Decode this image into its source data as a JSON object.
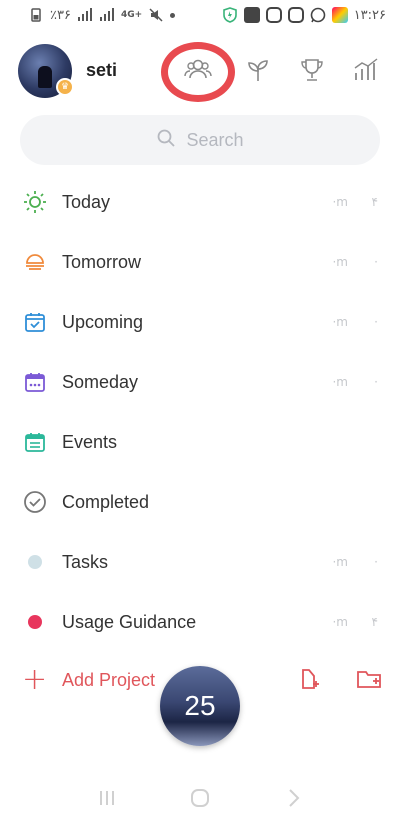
{
  "status_bar": {
    "battery": "٪۳۶",
    "network": "4G+",
    "time": "۱۳:۲۶"
  },
  "header": {
    "username": "seti",
    "icons": [
      "people-icon",
      "sprout-icon",
      "trophy-icon",
      "stats-icon"
    ]
  },
  "search": {
    "placeholder": "Search"
  },
  "lists": [
    {
      "label": "Today",
      "icon": "sun-icon",
      "count": "۴",
      "minutes": "·m",
      "color": "#4caf50"
    },
    {
      "label": "Tomorrow",
      "icon": "sunset-icon",
      "count": "·",
      "minutes": "·m",
      "color": "#f08a3c"
    },
    {
      "label": "Upcoming",
      "icon": "calendar-check-icon",
      "count": "·",
      "minutes": "·m",
      "color": "#2f8fd8"
    },
    {
      "label": "Someday",
      "icon": "calendar-dots-icon",
      "count": "·",
      "minutes": "·m",
      "color": "#7b5ad6"
    },
    {
      "label": "Events",
      "icon": "calendar-grid-icon",
      "count": "",
      "minutes": "",
      "color": "#2bb89a"
    },
    {
      "label": "Completed",
      "icon": "check-circle-icon",
      "count": "",
      "minutes": "",
      "color": "#777777"
    },
    {
      "label": "Tasks",
      "icon": "dot-icon",
      "count": "·",
      "minutes": "·m",
      "color": "#cfe0e6"
    },
    {
      "label": "Usage Guidance",
      "icon": "dot-icon",
      "count": "۴",
      "minutes": "·m",
      "color": "#e8365d"
    }
  ],
  "add_project": {
    "label": "Add Project"
  },
  "timer": {
    "value": "25"
  },
  "colors": {
    "accent": "#e0565b",
    "highlight": "#e84a4f"
  }
}
